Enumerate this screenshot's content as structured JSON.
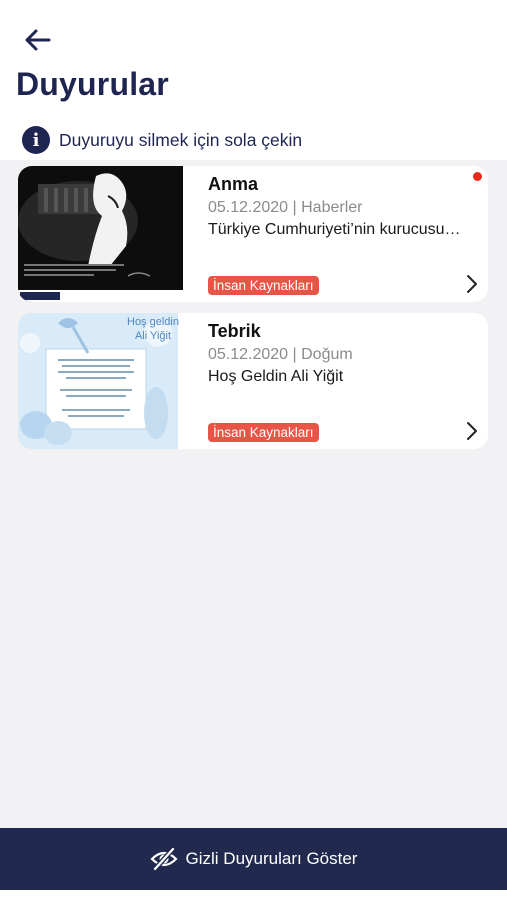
{
  "header": {
    "title": "Duyurular",
    "hint": "Duyuruyu silmek için sola çekin",
    "info_icon_glyph": "i"
  },
  "announcements": [
    {
      "title": "Anma",
      "meta": "05.12.2020 | Haberler",
      "description": "Türkiye Cumhuriyeti’nin kurucusu…",
      "tag": "İnsan Kaynakları",
      "unread": true,
      "thumbnail_icon": "memorial-image"
    },
    {
      "title": "Tebrik",
      "meta": "05.12.2020 | Doğum",
      "description": "Hoş Geldin Ali Yiğit",
      "tag": "İnsan Kaynakları",
      "unread": false,
      "thumbnail_icon": "baby-welcome-image",
      "thumbnail_caption": "Hoş geldin Ali Yiğit"
    }
  ],
  "footer": {
    "label": "Gizli Duyuruları Göster",
    "icon": "eye-slash-icon"
  },
  "colors": {
    "navy": "#1e2550",
    "footer_bg": "#212a4e",
    "tag_red": "#e85446",
    "unread_dot": "#e8291c"
  }
}
